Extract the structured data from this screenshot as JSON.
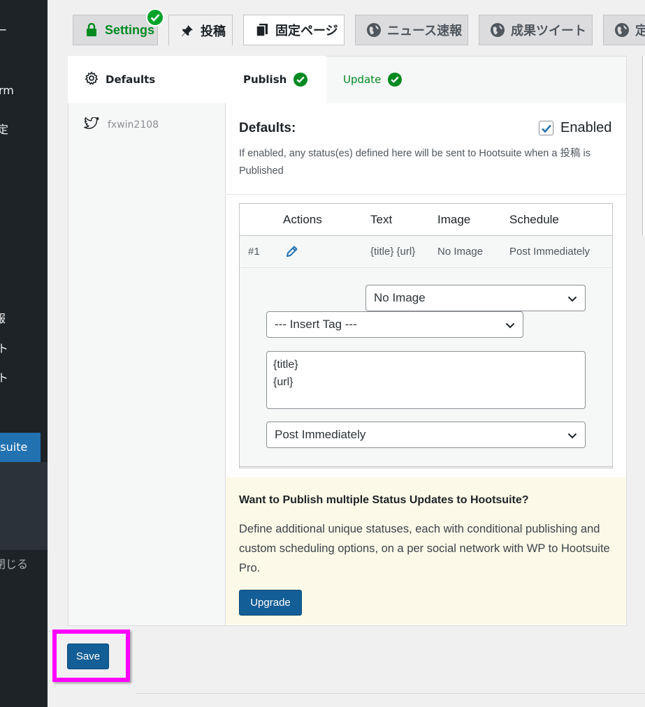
{
  "sidebar": {
    "fragments": [
      "ー",
      "rm",
      "定",
      "ー",
      "報",
      "ト",
      "ト"
    ],
    "active_item": "tsuite",
    "collapse_label": "閉じる"
  },
  "tabs": [
    {
      "label": "Settings",
      "icon": "lock-icon",
      "status": "check"
    },
    {
      "label": "投稿",
      "icon": "pin-icon"
    },
    {
      "label": "固定ページ",
      "icon": "pages-icon"
    },
    {
      "label": "ニュース速報",
      "icon": "globe-icon"
    },
    {
      "label": "成果ツイート",
      "icon": "globe-icon"
    },
    {
      "label": "定",
      "icon": "globe-icon"
    }
  ],
  "subnav": {
    "defaults": "Defaults",
    "publish": "Publish",
    "update": "Update"
  },
  "account": {
    "name": "fxwin2108",
    "icon": "twitter-icon"
  },
  "defaults": {
    "title": "Defaults:",
    "enabled_label": "Enabled",
    "enabled": true,
    "description": "If enabled, any status(es) defined here will be sent to Hootsuite when a 投稿 is Published"
  },
  "table": {
    "headers": [
      "Actions",
      "Text",
      "Image",
      "Schedule"
    ],
    "rows": [
      {
        "index": "#1",
        "text": "{title} {url}",
        "image": "No Image",
        "schedule": "Post Immediately"
      }
    ]
  },
  "editor": {
    "image_select": "No Image",
    "tag_select": "--- Insert Tag ---",
    "message": "{title}\n{url}",
    "schedule_select": "Post Immediately"
  },
  "promo": {
    "title": "Want to Publish multiple Status Updates to Hootsuite?",
    "text": "Define additional unique statuses, each with conditional publishing and custom scheduling options, on a per social network with WP to Hootsuite Pro.",
    "button": "Upgrade"
  },
  "actions": {
    "save": "Save"
  },
  "colors": {
    "accent": "#135e96",
    "success": "#008a20",
    "highlight": "#ff00ff",
    "sidebar": "#1d2327",
    "active": "#2271b1"
  }
}
